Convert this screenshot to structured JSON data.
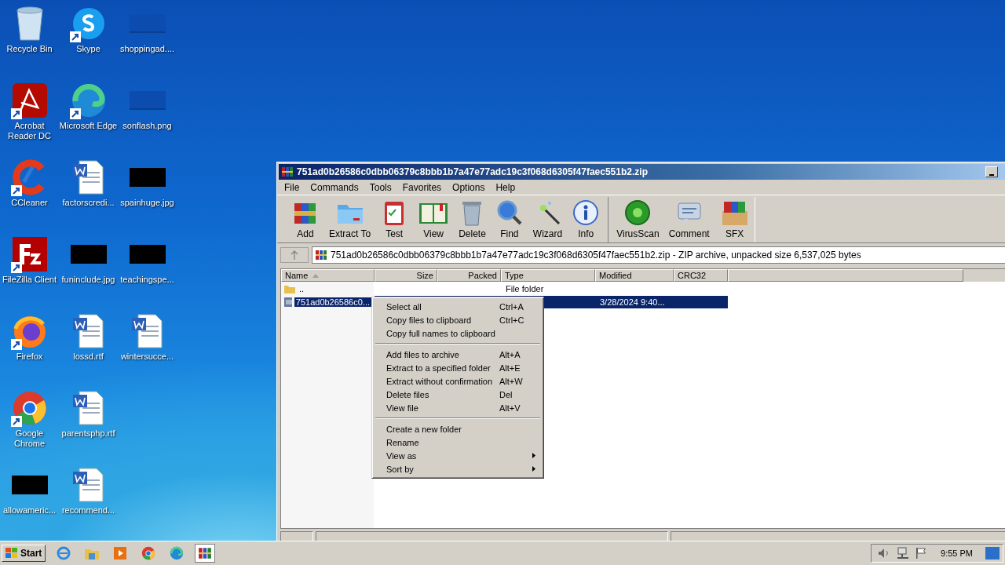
{
  "desktop": {
    "icons": [
      {
        "label": "Recycle Bin",
        "kind": "system"
      },
      {
        "label": "Skype",
        "kind": "shortcut"
      },
      {
        "label": "shoppingad....",
        "kind": "blank"
      },
      {
        "label": "Acrobat Reader DC",
        "kind": "shortcut"
      },
      {
        "label": "Microsoft Edge",
        "kind": "shortcut"
      },
      {
        "label": "sonflash.png",
        "kind": "blank"
      },
      {
        "label": "CCleaner",
        "kind": "shortcut"
      },
      {
        "label": "factorscredi...",
        "kind": "document"
      },
      {
        "label": "spainhuge.jpg",
        "kind": "thumbnail"
      },
      {
        "label": "FileZilla Client",
        "kind": "shortcut"
      },
      {
        "label": "funinclude.jpg",
        "kind": "thumbnail"
      },
      {
        "label": "teachingspe...",
        "kind": "thumbnail"
      },
      {
        "label": "Firefox",
        "kind": "shortcut"
      },
      {
        "label": "lossd.rtf",
        "kind": "document"
      },
      {
        "label": "wintersucce...",
        "kind": "document"
      },
      {
        "label": "Google Chrome",
        "kind": "shortcut"
      },
      {
        "label": "parentsphp.rtf",
        "kind": "document"
      },
      {
        "kind": "empty"
      },
      {
        "label": "allowameric...",
        "kind": "thumbnail"
      },
      {
        "label": "recommend...",
        "kind": "document"
      }
    ]
  },
  "window": {
    "title": "751ad0b26586c0dbb06379c8bbb1b7a47e77adc19c3f068d6305f47faec551b2.zip",
    "menu": [
      "File",
      "Commands",
      "Tools",
      "Favorites",
      "Options",
      "Help"
    ],
    "toolbar": [
      {
        "buttons": [
          "Add",
          "Extract To",
          "Test",
          "View",
          "Delete",
          "Find",
          "Wizard",
          "Info"
        ]
      },
      {
        "buttons": [
          "VirusScan",
          "Comment",
          "SFX"
        ]
      }
    ],
    "address": "751ad0b26586c0dbb06379c8bbb1b7a47e77adc19c3f068d6305f47faec551b2.zip - ZIP archive, unpacked size 6,537,025 bytes",
    "table": {
      "columns": [
        "Name",
        "Size",
        "Packed",
        "Type",
        "Modified",
        "CRC32"
      ],
      "rows": [
        {
          "kind": "folder",
          "selected": false,
          "cells": [
            "..",
            "",
            "",
            "File folder",
            "",
            ""
          ]
        },
        {
          "kind": "file",
          "selected": true,
          "cells": [
            "751ad0b26586c0...",
            "",
            "",
            "",
            "3/28/2024 9:40...",
            ""
          ]
        }
      ]
    }
  },
  "context_menu": {
    "groups": [
      {
        "items": [
          {
            "label": "Select all",
            "shortcut": "Ctrl+A",
            "submenu": false
          },
          {
            "label": "Copy files to clipboard",
            "shortcut": "Ctrl+C",
            "submenu": false
          },
          {
            "label": "Copy full names to clipboard",
            "submenu": false
          }
        ]
      },
      {
        "items": [
          {
            "label": "Add files to archive",
            "shortcut": "Alt+A",
            "submenu": false
          },
          {
            "label": "Extract to a specified folder",
            "shortcut": "Alt+E",
            "submenu": false
          },
          {
            "label": "Extract without confirmation",
            "shortcut": "Alt+W",
            "submenu": false
          },
          {
            "label": "Delete files",
            "shortcut": "Del",
            "submenu": false
          },
          {
            "label": "View file",
            "shortcut": "Alt+V",
            "submenu": false
          }
        ]
      },
      {
        "items": [
          {
            "label": "Create a new folder",
            "submenu": false
          },
          {
            "label": "Rename",
            "submenu": false
          },
          {
            "label": "View as",
            "submenu": true
          },
          {
            "label": "Sort by",
            "submenu": true
          }
        ]
      }
    ]
  },
  "taskbar": {
    "start": "Start",
    "clock": "9:55 PM"
  }
}
